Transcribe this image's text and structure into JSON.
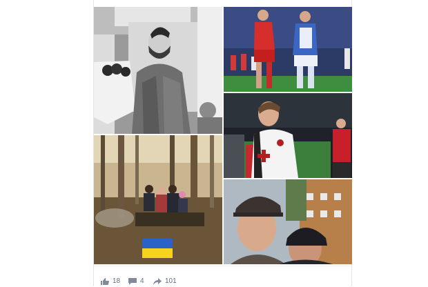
{
  "post": {
    "photos": [
      {
        "name": "memorial-portrait",
        "description_icon": "photo-icon"
      },
      {
        "name": "football-match-red-vs-blue",
        "description_icon": "photo-icon"
      },
      {
        "name": "football-player-white-kit",
        "description_icon": "photo-icon"
      },
      {
        "name": "family-in-forest",
        "description_icon": "photo-icon"
      },
      {
        "name": "selfie-couple",
        "description_icon": "photo-icon"
      }
    ],
    "footer": {
      "likes": "18",
      "comments": "4",
      "shares": "101"
    }
  },
  "colors": {
    "action_text": "#626d7a",
    "flag_blue": "#2a62c7",
    "flag_yellow": "#f5d31e"
  }
}
